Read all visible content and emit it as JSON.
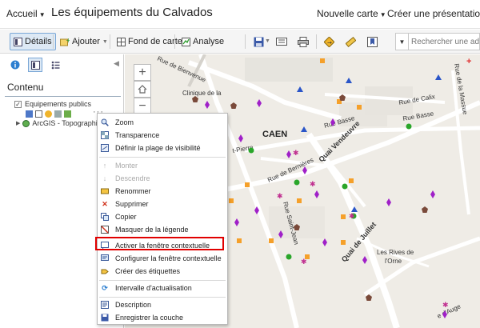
{
  "header": {
    "home_label": "Accueil",
    "title": "Les équipements du Calvados",
    "new_map_label": "Nouvelle carte",
    "create_presentation_label": "Créer une présentation"
  },
  "toolbar": {
    "details_label": "Détails",
    "add_label": "Ajouter",
    "basemap_label": "Fond de carte",
    "analysis_label": "Analyse",
    "search_placeholder": "Rechercher une adresse"
  },
  "panel": {
    "contents_title": "Contenu",
    "layers": [
      {
        "name": "Equipements publics",
        "checked": true
      },
      {
        "name": "ArcGIS - Topographic"
      }
    ]
  },
  "context_menu": {
    "items": [
      {
        "label": "Zoom",
        "icon": "magnifier-icon"
      },
      {
        "label": "Transparence",
        "icon": "transparency-icon"
      },
      {
        "label": "Définir la plage de visibilité",
        "icon": "visibility-range-icon"
      },
      {
        "label": "Monter",
        "icon": "arrow-up-icon",
        "disabled": true
      },
      {
        "label": "Descendre",
        "icon": "arrow-down-icon",
        "disabled": true
      },
      {
        "label": "Renommer",
        "icon": "rename-icon"
      },
      {
        "label": "Supprimer",
        "icon": "delete-icon"
      },
      {
        "label": "Copier",
        "icon": "copy-icon"
      },
      {
        "label": "Masquer de la légende",
        "icon": "hide-legend-icon"
      },
      {
        "label": "Activer la fenêtre contextuelle",
        "icon": "popup-enable-icon",
        "highlighted": true
      },
      {
        "label": "Configurer la fenêtre contextuelle",
        "icon": "popup-config-icon"
      },
      {
        "label": "Créer des étiquettes",
        "icon": "labels-icon"
      },
      {
        "label": "Intervalle d'actualisation",
        "icon": "refresh-icon"
      },
      {
        "label": "Description",
        "icon": "description-icon"
      },
      {
        "label": "Enregistrer la couche",
        "icon": "save-layer-icon"
      }
    ]
  },
  "map": {
    "labels": {
      "city": "CAEN",
      "rue_bienvenue": "Rue de Bienvenue",
      "clinique": "Clinique de la",
      "rue_calix": "Rue de Calix",
      "rue_basse_1": "Rue Basse",
      "rue_basse_2": "Rue Basse",
      "rue_massue": "Rue de la Massue",
      "saint_pierre": "t-Pierre",
      "quai_vendeuvre": "Quai Vendeuvre",
      "rue_bernieres": "Rue de Bernières",
      "rue_saint_jean": "Rue Saint-Jean",
      "quai_juillet": "Quai de Juillet",
      "rives_orne_1": "Les Rives de",
      "rives_orne_2": "l'Orne",
      "rue_auge": "e d'Auge"
    }
  },
  "colors": {
    "accent_blue": "#dde9f5",
    "highlight_red": "#e10000",
    "marker_purple": "#a020c8",
    "marker_orange": "#f5a02a",
    "marker_green": "#2aa62a",
    "marker_blue": "#2a55c8",
    "marker_brown": "#7a4a3a"
  }
}
